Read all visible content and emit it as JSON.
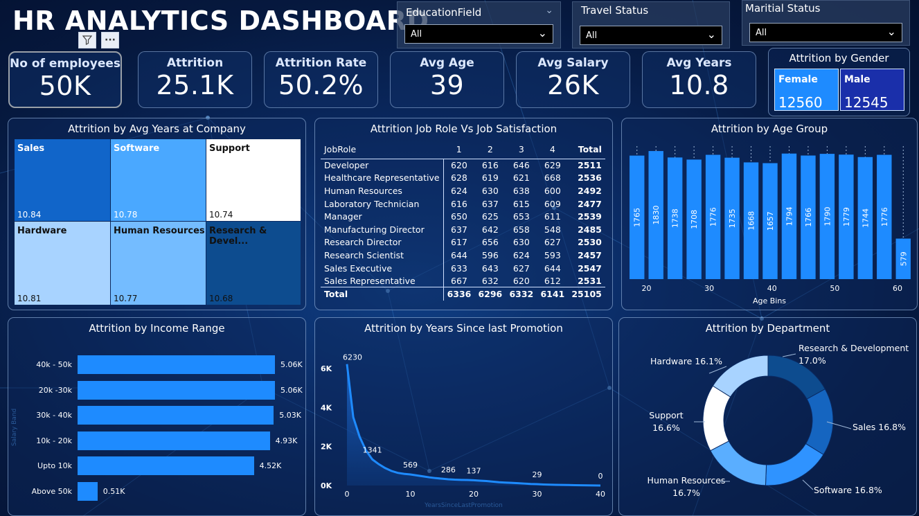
{
  "header": {
    "title": "HR ANALYTICS DASHBOARD",
    "filter_icon": "filter-icon",
    "more_icon": "more-options-icon"
  },
  "slicers": [
    {
      "label": "EducationField",
      "value": "All"
    },
    {
      "label": "Travel Status",
      "value": "All"
    },
    {
      "label": "Maritial Status",
      "value": "All"
    }
  ],
  "kpis": [
    {
      "label": "No of employees",
      "value": "50K"
    },
    {
      "label": "Attrition",
      "value": "25.1K"
    },
    {
      "label": "Attrition Rate",
      "value": "50.2%"
    },
    {
      "label": "Avg Age",
      "value": "39"
    },
    {
      "label": "Avg Salary",
      "value": "26K"
    },
    {
      "label": "Avg Years",
      "value": "10.8"
    }
  ],
  "gender": {
    "title": "Attrition by Gender",
    "female_label": "Female",
    "female_value": "12560",
    "male_label": "Male",
    "male_value": "12545"
  },
  "treemap": {
    "title": "Attrition by Avg Years at Company",
    "cells": [
      {
        "label": "Sales",
        "value": "10.84",
        "color": "#1165c9"
      },
      {
        "label": "Software",
        "value": "10.78",
        "color": "#4aa8ff"
      },
      {
        "label": "Support",
        "value": "10.74",
        "color": "#ffffff"
      },
      {
        "label": "Hardware",
        "value": "10.81",
        "color": "#a8d3ff"
      },
      {
        "label": "Human Resources",
        "value": "10.77",
        "color": "#74bcff"
      },
      {
        "label": "Research & Devel...",
        "value": "10.68",
        "color": "#0d4c8f"
      }
    ]
  },
  "jobrole": {
    "title": "Attrition Job Role Vs Job Satisfaction",
    "headers": [
      "JobRole",
      "1",
      "2",
      "3",
      "4",
      "Total"
    ],
    "rows": [
      [
        "Developer",
        "620",
        "616",
        "646",
        "629",
        "2511"
      ],
      [
        "Healthcare Representative",
        "628",
        "619",
        "621",
        "668",
        "2536"
      ],
      [
        "Human Resources",
        "624",
        "630",
        "638",
        "600",
        "2492"
      ],
      [
        "Laboratory Technician",
        "616",
        "637",
        "615",
        "609",
        "2477"
      ],
      [
        "Manager",
        "650",
        "625",
        "653",
        "611",
        "2539"
      ],
      [
        "Manufacturing Director",
        "637",
        "642",
        "658",
        "548",
        "2485"
      ],
      [
        "Research Director",
        "617",
        "656",
        "630",
        "627",
        "2530"
      ],
      [
        "Research Scientist",
        "644",
        "596",
        "624",
        "593",
        "2457"
      ],
      [
        "Sales Executive",
        "633",
        "643",
        "627",
        "644",
        "2547"
      ],
      [
        "Sales Representative",
        "667",
        "632",
        "620",
        "612",
        "2531"
      ]
    ],
    "total": [
      "Total",
      "6336",
      "6296",
      "6332",
      "6141",
      "25105"
    ]
  },
  "chart_data": [
    {
      "type": "bar",
      "title": "Attrition by Age Group",
      "xlabel": "Age Bins",
      "ylabel": "",
      "x_ticks": [
        "20",
        "30",
        "40",
        "50",
        "60"
      ],
      "values": [
        1765,
        1830,
        1738,
        1708,
        1776,
        1735,
        1668,
        1657,
        1794,
        1766,
        1790,
        1779,
        1744,
        1776,
        579
      ],
      "ylim": [
        0,
        1900
      ],
      "color": "#1e8bff"
    },
    {
      "type": "bar",
      "orientation": "horizontal",
      "title": "Attrition by Income Range",
      "ylabel": "Salary Band",
      "xlabel": "",
      "categories": [
        "40k - 50k",
        "20k -30k",
        "30k - 40k",
        "10k - 20k",
        "Upto 10k",
        "Above 50k"
      ],
      "values": [
        5060,
        5060,
        5030,
        4930,
        4520,
        510
      ],
      "labels": [
        "5.06K",
        "5.06K",
        "5.03K",
        "4.93K",
        "4.52K",
        "0.51K"
      ],
      "color": "#1e8bff"
    },
    {
      "type": "area",
      "title": "Attrition by Years Since last Promotion",
      "xlabel": "YearsSinceLastPromotion",
      "ylabel": "",
      "x": [
        0,
        1,
        2,
        3,
        4,
        5,
        6,
        7,
        8,
        9,
        10,
        11,
        12,
        13,
        14,
        15,
        16,
        17,
        18,
        19,
        20,
        21,
        22,
        23,
        24,
        25,
        26,
        27,
        28,
        29,
        30,
        31,
        32,
        33,
        34,
        35,
        36,
        37,
        38,
        39,
        40
      ],
      "y": [
        6230,
        3500,
        2500,
        1800,
        1341,
        1100,
        900,
        750,
        650,
        600,
        569,
        520,
        470,
        420,
        380,
        350,
        320,
        300,
        290,
        286,
        270,
        250,
        230,
        200,
        170,
        150,
        137,
        120,
        100,
        80,
        70,
        55,
        45,
        35,
        29,
        25,
        18,
        12,
        8,
        4,
        0
      ],
      "data_labels": [
        {
          "x": 0,
          "text": "6230"
        },
        {
          "x": 4,
          "text": "1341"
        },
        {
          "x": 10,
          "text": "569"
        },
        {
          "x": 16,
          "text": "286"
        },
        {
          "x": 20,
          "text": "137"
        },
        {
          "x": 30,
          "text": "29"
        },
        {
          "x": 40,
          "text": "0"
        }
      ],
      "y_ticks": [
        "0K",
        "2K",
        "4K",
        "6K"
      ],
      "x_ticks": [
        "0",
        "10",
        "20",
        "30",
        "40"
      ],
      "ylim": [
        0,
        7000
      ],
      "xlim": [
        0,
        40
      ],
      "color": "#1e8bff"
    },
    {
      "type": "pie",
      "title": "Attrition by Department",
      "donut": true,
      "slices": [
        {
          "name": "Research & Development",
          "pct": 17.0,
          "color": "#0d4c8f",
          "label": "Research & Development\n17.0%"
        },
        {
          "name": "Sales",
          "pct": 16.8,
          "color": "#1565c0",
          "label": "Sales 16.8%"
        },
        {
          "name": "Software",
          "pct": 16.8,
          "color": "#2f93ff",
          "label": "Software 16.8%"
        },
        {
          "name": "Human Resources",
          "pct": 16.7,
          "color": "#5aaeff",
          "label": "Human Resources\n16.7%"
        },
        {
          "name": "Support",
          "pct": 16.6,
          "color": "#ffffff",
          "label": "Support\n16.6%"
        },
        {
          "name": "Hardware",
          "pct": 16.1,
          "color": "#a8d3ff",
          "label": "Hardware 16.1%"
        }
      ]
    }
  ]
}
